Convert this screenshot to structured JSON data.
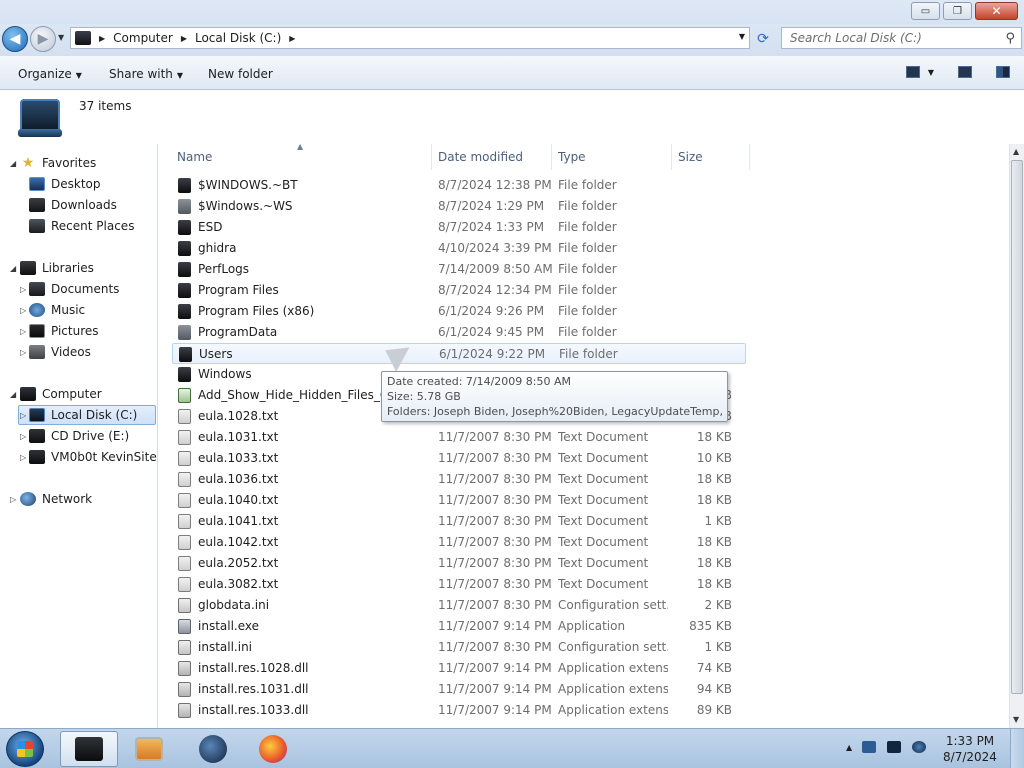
{
  "window": {
    "minimize": "▭",
    "maximize": "❐",
    "close": "✕"
  },
  "address": {
    "crumbs": [
      "Computer",
      "Local Disk (C:)"
    ],
    "search_placeholder": "Search Local Disk (C:)"
  },
  "toolbar": {
    "organize": "Organize",
    "share_with": "Share with",
    "new_folder": "New folder"
  },
  "info": {
    "item_count": "37 items"
  },
  "nav": {
    "favorites": {
      "label": "Favorites",
      "items": [
        "Desktop",
        "Downloads",
        "Recent Places"
      ]
    },
    "libraries": {
      "label": "Libraries",
      "items": [
        "Documents",
        "Music",
        "Pictures",
        "Videos"
      ]
    },
    "computer": {
      "label": "Computer",
      "items": [
        "Local Disk (C:)",
        "CD Drive (E:)",
        "VM0b0t KevinSite"
      ]
    },
    "network": {
      "label": "Network"
    }
  },
  "columns": {
    "name": "Name",
    "date": "Date modified",
    "type": "Type",
    "size": "Size"
  },
  "files": [
    {
      "name": "$WINDOWS.~BT",
      "date": "8/7/2024 12:38 PM",
      "type": "File folder",
      "size": "",
      "icon": "folder"
    },
    {
      "name": "$Windows.~WS",
      "date": "8/7/2024 1:29 PM",
      "type": "File folder",
      "size": "",
      "icon": "folder-light"
    },
    {
      "name": "ESD",
      "date": "8/7/2024 1:33 PM",
      "type": "File folder",
      "size": "",
      "icon": "folder"
    },
    {
      "name": "ghidra",
      "date": "4/10/2024 3:39 PM",
      "type": "File folder",
      "size": "",
      "icon": "folder"
    },
    {
      "name": "PerfLogs",
      "date": "7/14/2009 8:50 AM",
      "type": "File folder",
      "size": "",
      "icon": "folder"
    },
    {
      "name": "Program Files",
      "date": "8/7/2024 12:34 PM",
      "type": "File folder",
      "size": "",
      "icon": "folder"
    },
    {
      "name": "Program Files (x86)",
      "date": "6/1/2024 9:26 PM",
      "type": "File folder",
      "size": "",
      "icon": "folder"
    },
    {
      "name": "ProgramData",
      "date": "6/1/2024 9:45 PM",
      "type": "File folder",
      "size": "",
      "icon": "folder-light"
    },
    {
      "name": "Users",
      "date": "6/1/2024 9:22 PM",
      "type": "File folder",
      "size": "",
      "icon": "folder"
    },
    {
      "name": "Windows",
      "date": "",
      "type": "",
      "size": "",
      "icon": "folder"
    },
    {
      "name": "Add_Show_Hide_Hidden_Files_Opt",
      "date": "",
      "type": "",
      "size": "KB",
      "icon": "reg"
    },
    {
      "name": "eula.1028.txt",
      "date": "",
      "type": "",
      "size": "KB",
      "icon": "txt"
    },
    {
      "name": "eula.1031.txt",
      "date": "11/7/2007 8:30 PM",
      "type": "Text Document",
      "size": "18 KB",
      "icon": "txt"
    },
    {
      "name": "eula.1033.txt",
      "date": "11/7/2007 8:30 PM",
      "type": "Text Document",
      "size": "10 KB",
      "icon": "txt"
    },
    {
      "name": "eula.1036.txt",
      "date": "11/7/2007 8:30 PM",
      "type": "Text Document",
      "size": "18 KB",
      "icon": "txt"
    },
    {
      "name": "eula.1040.txt",
      "date": "11/7/2007 8:30 PM",
      "type": "Text Document",
      "size": "18 KB",
      "icon": "txt"
    },
    {
      "name": "eula.1041.txt",
      "date": "11/7/2007 8:30 PM",
      "type": "Text Document",
      "size": "1 KB",
      "icon": "txt"
    },
    {
      "name": "eula.1042.txt",
      "date": "11/7/2007 8:30 PM",
      "type": "Text Document",
      "size": "18 KB",
      "icon": "txt"
    },
    {
      "name": "eula.2052.txt",
      "date": "11/7/2007 8:30 PM",
      "type": "Text Document",
      "size": "18 KB",
      "icon": "txt"
    },
    {
      "name": "eula.3082.txt",
      "date": "11/7/2007 8:30 PM",
      "type": "Text Document",
      "size": "18 KB",
      "icon": "txt"
    },
    {
      "name": "globdata.ini",
      "date": "11/7/2007 8:30 PM",
      "type": "Configuration sett...",
      "size": "2 KB",
      "icon": "ini"
    },
    {
      "name": "install.exe",
      "date": "11/7/2007 9:14 PM",
      "type": "Application",
      "size": "835 KB",
      "icon": "exe"
    },
    {
      "name": "install.ini",
      "date": "11/7/2007 8:30 PM",
      "type": "Configuration sett...",
      "size": "1 KB",
      "icon": "ini"
    },
    {
      "name": "install.res.1028.dll",
      "date": "11/7/2007 9:14 PM",
      "type": "Application extens...",
      "size": "74 KB",
      "icon": "dll"
    },
    {
      "name": "install.res.1031.dll",
      "date": "11/7/2007 9:14 PM",
      "type": "Application extens...",
      "size": "94 KB",
      "icon": "dll"
    },
    {
      "name": "install.res.1033.dll",
      "date": "11/7/2007 9:14 PM",
      "type": "Application extens...",
      "size": "89 KB",
      "icon": "dll"
    }
  ],
  "tooltip": {
    "created": "Date created: 7/14/2009 8:50 AM",
    "size": "Size: 5.78 GB",
    "folders": "Folders: Joseph Biden, Joseph%20Biden, LegacyUpdateTemp, ..."
  },
  "clock": {
    "time": "1:33 PM",
    "date": "8/7/2024"
  }
}
